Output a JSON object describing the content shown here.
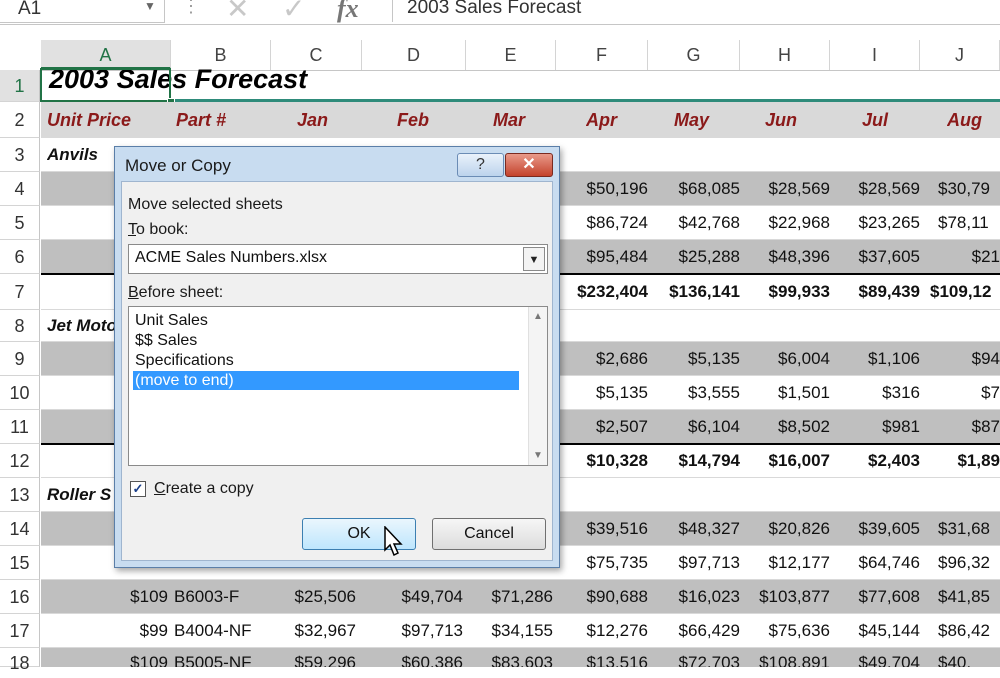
{
  "formula_bar": {
    "name_box": "A1",
    "dots": "⋮",
    "cancel_glyph": "✕",
    "enter_glyph": "✓",
    "fx_glyph": "fx",
    "content": "2003 Sales Forecast"
  },
  "columns": [
    "A",
    "B",
    "C",
    "D",
    "E",
    "F",
    "G",
    "H",
    "I",
    "J"
  ],
  "rows": [
    "1",
    "2",
    "3",
    "4",
    "5",
    "6",
    "7",
    "8",
    "9",
    "10",
    "11",
    "12",
    "13",
    "14",
    "15",
    "16",
    "17",
    "18"
  ],
  "sheet": {
    "title": "2003 Sales Forecast",
    "headers": [
      "Unit Price",
      "Part #",
      "Jan",
      "Feb",
      "Mar",
      "Apr",
      "May",
      "Jun",
      "Jul",
      "Aug"
    ],
    "cat_anvils": "Anvils",
    "cat_jet": "Jet Moto",
    "cat_roller": "Roller S",
    "r4": [
      "$50,196",
      "$68,085",
      "$28,569",
      "$28,569",
      "$30,79"
    ],
    "r5": [
      "$86,724",
      "$42,768",
      "$22,968",
      "$23,265",
      "$78,11"
    ],
    "r6": [
      "$95,484",
      "$25,288",
      "$48,396",
      "$37,605",
      "$21"
    ],
    "r7": [
      "$232,404",
      "$136,141",
      "$99,933",
      "$89,439",
      "$109,12"
    ],
    "r9": [
      "$2,686",
      "$5,135",
      "$6,004",
      "$1,106",
      "$94"
    ],
    "r10": [
      "$5,135",
      "$3,555",
      "$1,501",
      "$316",
      "$7"
    ],
    "r11": [
      "$2,507",
      "$6,104",
      "$8,502",
      "$981",
      "$87"
    ],
    "r12": [
      "$10,328",
      "$14,794",
      "$16,007",
      "$2,403",
      "$1,89"
    ],
    "r14": [
      "$39,516",
      "$48,327",
      "$20,826",
      "$39,605",
      "$31,68"
    ],
    "r15": [
      "$75,735",
      "$97,713",
      "$12,177",
      "$64,746",
      "$96,32"
    ],
    "r16": [
      "$109",
      "B6003-F",
      "$25,506",
      "$49,704",
      "$71,286",
      "$90,688",
      "$16,023",
      "$103,877",
      "$77,608",
      "$41,85"
    ],
    "r17": [
      "$99",
      "B4004-NF",
      "$32,967",
      "$97,713",
      "$34,155",
      "$12,276",
      "$66,429",
      "$75,636",
      "$45,144",
      "$86,42"
    ],
    "r18": [
      "$109",
      "B5005-NF",
      "$59,296",
      "$60,386",
      "$83,603",
      "$13,516",
      "$72,703",
      "$108,891",
      "$49,704",
      "$40,"
    ]
  },
  "dialog": {
    "title": "Move or Copy",
    "help": "?",
    "close": "✕",
    "move_label": "Move selected sheets",
    "to_book_label_key": "T",
    "to_book_label_rest": "o book:",
    "to_book_value": "ACME Sales Numbers.xlsx",
    "before_sheet_key": "B",
    "before_sheet_rest": "efore sheet:",
    "sheets": [
      "Unit Sales",
      "$$ Sales",
      "Specifications",
      "(move to end)"
    ],
    "create_copy_key": "C",
    "create_copy_rest": "reate a copy",
    "create_copy_checked": "✓",
    "ok": "OK",
    "cancel": "Cancel"
  }
}
